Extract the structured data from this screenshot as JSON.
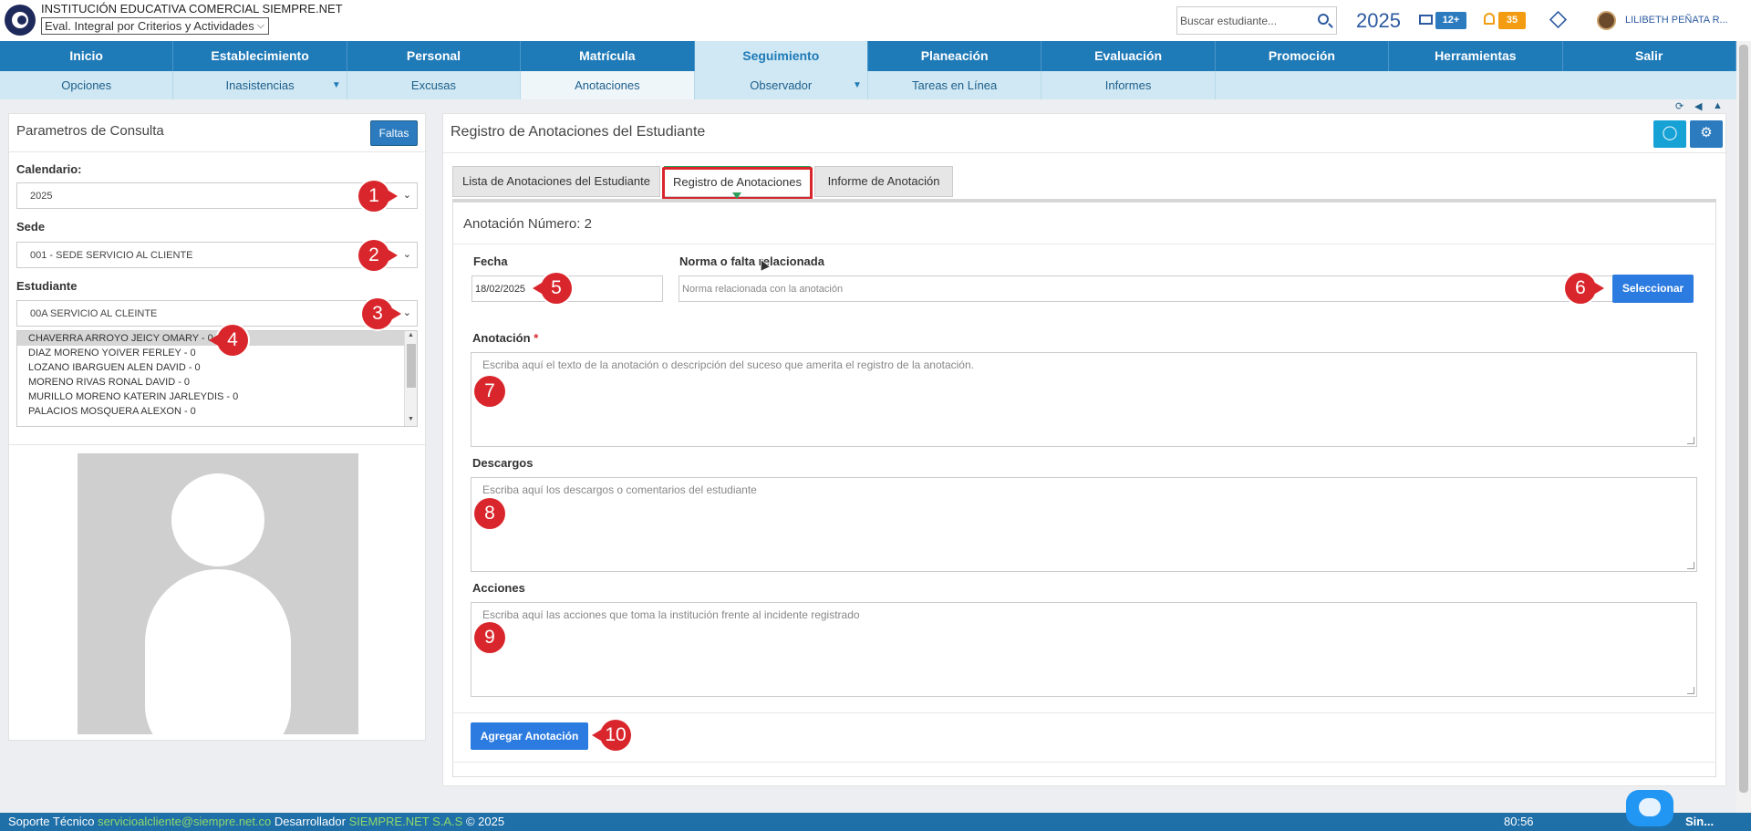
{
  "header": {
    "school_name": "INSTITUCIÓN EDUCATIVA COMERCIAL SIEMPRE.NET",
    "eval_mode": "Eval. Integral por Criterios y Actividades",
    "search_placeholder": "Buscar estudiante...",
    "year": "2025",
    "mail_count": "12+",
    "notifications_count": "35",
    "user_name": "LILIBETH PEÑATA R...",
    "colors": {
      "brand": "#1f7ab8",
      "mail_badge": "#2c7bbf",
      "bell_badge": "#f39c12"
    }
  },
  "main_nav": [
    {
      "label": "Inicio"
    },
    {
      "label": "Establecimiento"
    },
    {
      "label": "Personal"
    },
    {
      "label": "Matrícula"
    },
    {
      "label": "Seguimiento",
      "active": true
    },
    {
      "label": "Planeación"
    },
    {
      "label": "Evaluación"
    },
    {
      "label": "Promoción"
    },
    {
      "label": "Herramientas"
    },
    {
      "label": "Salir"
    }
  ],
  "sub_nav": [
    {
      "label": "Opciones"
    },
    {
      "label": "Inasistencias",
      "dropdown": true
    },
    {
      "label": "Excusas"
    },
    {
      "label": "Anotaciones",
      "active": true
    },
    {
      "label": "Observador",
      "dropdown": true
    },
    {
      "label": "Tareas en Línea"
    },
    {
      "label": "Informes"
    }
  ],
  "left_panel": {
    "title": "Parametros de Consulta",
    "faltas_button": "Faltas",
    "calendario_label": "Calendario:",
    "calendario_value": "2025",
    "sede_label": "Sede",
    "sede_value": "001 - SEDE SERVICIO AL CLIENTE",
    "estudiante_label": "Estudiante",
    "estudiante_value": "00A SERVICIO AL CLEINTE",
    "students": [
      "CHAVERRA ARROYO JEICY OMARY - 0",
      "DIAZ MORENO YOIVER FERLEY - 0",
      "LOZANO IBARGUEN ALEN DAVID - 0",
      "MORENO RIVAS RONAL DAVID - 0",
      "MURILLO MORENO KATERIN JARLEYDIS - 0",
      "PALACIOS MOSQUERA ALEXON - 0"
    ]
  },
  "right_panel": {
    "title": "Registro de Anotaciones del Estudiante",
    "tabs": [
      {
        "label": "Lista de Anotaciones del Estudiante"
      },
      {
        "label": "Registro de Anotaciones",
        "active": true
      },
      {
        "label": "Informe de Anotación"
      }
    ],
    "annotation_number": "Anotación Número: 2",
    "fecha_label": "Fecha",
    "fecha_value": "18/02/2025",
    "norma_label": "Norma o falta relacionada",
    "norma_placeholder": "Norma relacionada con la anotación",
    "select_button": "Seleccionar",
    "anotacion_label": "Anotación",
    "anotacion_required": "*",
    "anotacion_placeholder": "Escriba aquí el texto de la anotación o descripción del suceso que amerita el registro de la anotación.",
    "descargos_label": "Descargos",
    "descargos_placeholder": "Escriba aquí los descargos o comentarios del estudiante",
    "acciones_label": "Acciones",
    "acciones_placeholder": "Escriba aquí las acciones que toma la institución frente al incidente registrado",
    "add_button": "Agregar Anotación"
  },
  "callouts": [
    "1",
    "2",
    "3",
    "4",
    "5",
    "6",
    "7",
    "8",
    "9",
    "10"
  ],
  "footer": {
    "support_label": "Soporte Técnico",
    "support_email": "servicioalcliente@siempre.net.co",
    "developer_label": "Desarrollador",
    "developer_name": "SIEMPRE.NET S.A.S",
    "copyright": "© 2025",
    "timer": "80:56",
    "sin": "Sin..."
  }
}
